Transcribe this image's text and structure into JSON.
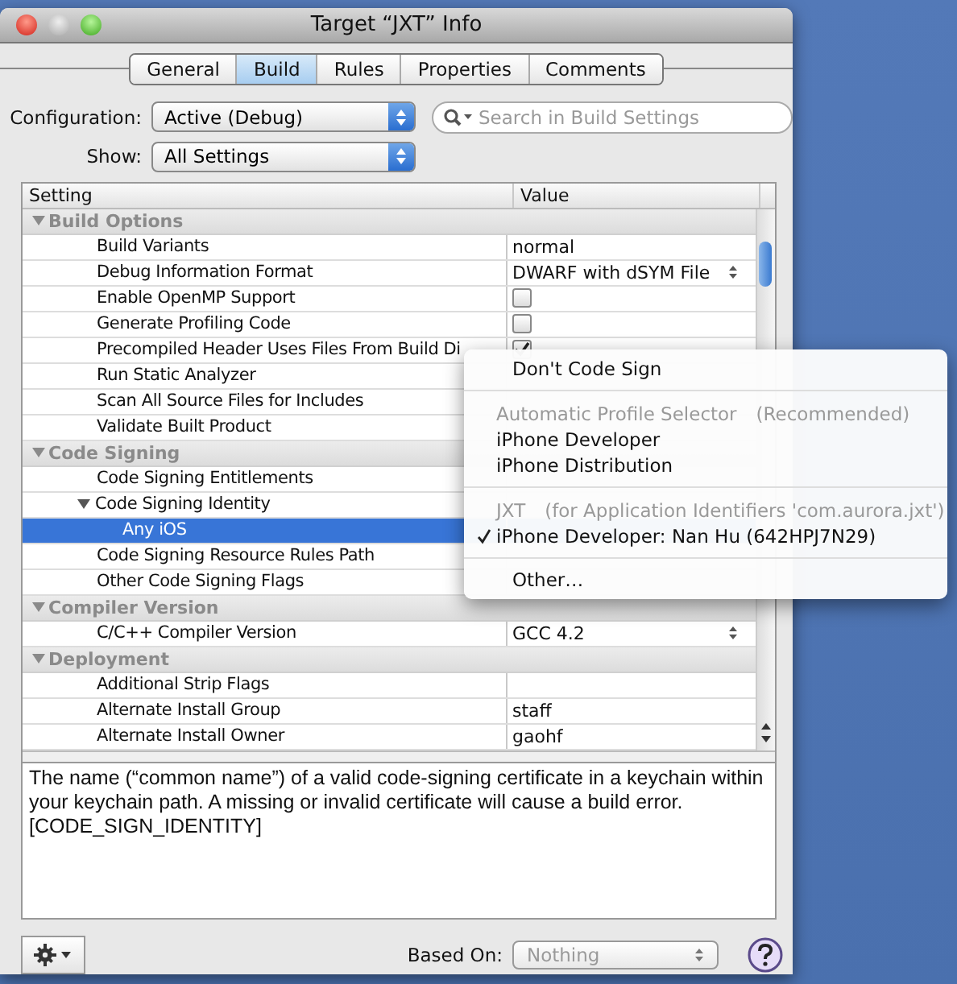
{
  "window": {
    "title": "Target “JXT” Info"
  },
  "tabs": [
    {
      "label": "General",
      "selected": false
    },
    {
      "label": "Build",
      "selected": true
    },
    {
      "label": "Rules",
      "selected": false
    },
    {
      "label": "Properties",
      "selected": false
    },
    {
      "label": "Comments",
      "selected": false
    }
  ],
  "configuration": {
    "label": "Configuration:",
    "value": "Active (Debug)"
  },
  "search": {
    "placeholder": "Search in Build Settings"
  },
  "show": {
    "label": "Show:",
    "value": "All Settings"
  },
  "table": {
    "columns": [
      "Setting",
      "Value"
    ],
    "rows": [
      {
        "kind": "group",
        "label": "Build Options",
        "expanded": true,
        "children": [
          {
            "label": "Build Variants",
            "selected": false,
            "value": {
              "kind": "text",
              "text": "normal"
            }
          },
          {
            "label": "Debug Information Format",
            "selected": false,
            "value": {
              "kind": "popup",
              "text": "DWARF with dSYM File"
            }
          },
          {
            "label": "Enable OpenMP Support",
            "selected": false,
            "value": {
              "kind": "checkbox",
              "checked": false
            }
          },
          {
            "label": "Generate Profiling Code",
            "selected": false,
            "value": {
              "kind": "checkbox",
              "checked": false
            }
          },
          {
            "label": "Precompiled Header Uses Files From Build Di",
            "selected": false,
            "value": {
              "kind": "checkbox",
              "checked": true
            }
          },
          {
            "label": "Run Static Analyzer",
            "selected": false
          },
          {
            "label": "Scan All Source Files for Includes",
            "selected": false
          },
          {
            "label": "Validate Built Product",
            "selected": false
          }
        ]
      },
      {
        "kind": "group",
        "label": "Code Signing",
        "expanded": true,
        "children": [
          {
            "label": "Code Signing Entitlements",
            "selected": false
          },
          {
            "label": "Code Signing Identity",
            "selected": false,
            "expanded": true,
            "children": [
              {
                "label": "Any iOS",
                "selected": true
              }
            ]
          },
          {
            "label": "Code Signing Resource Rules Path",
            "selected": false
          },
          {
            "label": "Other Code Signing Flags",
            "selected": false
          }
        ]
      },
      {
        "kind": "group",
        "label": "Compiler Version",
        "expanded": true,
        "children": [
          {
            "label": "C/C++ Compiler Version",
            "selected": false,
            "value": {
              "kind": "popup",
              "text": "GCC 4.2"
            }
          }
        ]
      },
      {
        "kind": "group",
        "label": "Deployment",
        "expanded": true,
        "children": [
          {
            "label": "Additional Strip Flags",
            "selected": false
          },
          {
            "label": "Alternate Install Group",
            "selected": false,
            "value": {
              "kind": "text",
              "text": "staff"
            }
          },
          {
            "label": "Alternate Install Owner",
            "selected": false,
            "value": {
              "kind": "text",
              "text": "gaohf"
            }
          }
        ]
      }
    ]
  },
  "menu": {
    "sections": [
      {
        "items": [
          {
            "label": "Don't Code Sign",
            "checked": false
          }
        ]
      },
      {
        "header": "Automatic Profile Selector",
        "note": "(Recommended)",
        "items": [
          {
            "label": "iPhone Developer",
            "checked": false
          },
          {
            "label": "iPhone Distribution",
            "checked": false
          }
        ]
      },
      {
        "header": "JXT",
        "note": "(for Application Identifiers 'com.aurora.jxt')",
        "items": [
          {
            "label": "iPhone Developer: Nan Hu (642HPJ7N29)",
            "checked": true
          }
        ]
      },
      {
        "items": [
          {
            "label": "Other…",
            "checked": false
          }
        ]
      }
    ]
  },
  "description": "The name (“common name”) of a valid code-signing certificate in a keychain within your keychain path.   A missing or invalid certificate will cause a build error. [CODE_SIGN_IDENTITY]",
  "based_on": {
    "label": "Based On:",
    "value": "Nothing",
    "disabled": true
  }
}
